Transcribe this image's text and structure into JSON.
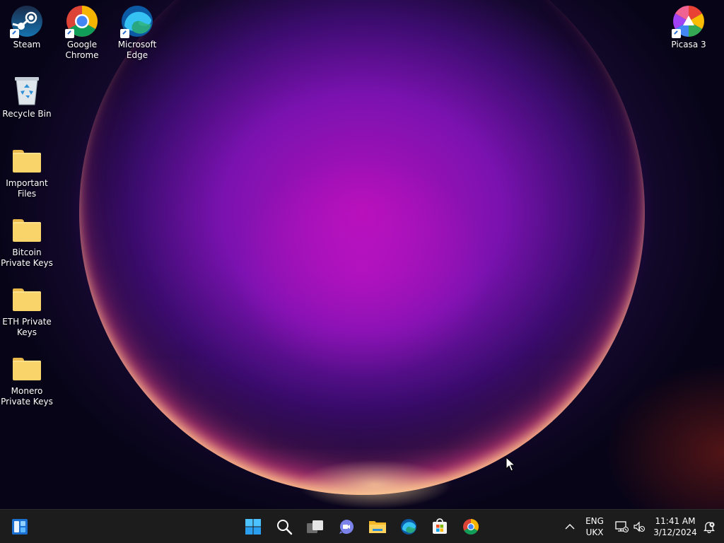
{
  "desktop": {
    "icons": [
      {
        "label": "Steam",
        "icon": "steam-icon"
      },
      {
        "label": "Google\nChrome",
        "icon": "chrome-icon"
      },
      {
        "label": "Microsoft\nEdge",
        "icon": "edge-icon"
      },
      {
        "label": "Picasa 3",
        "icon": "picasa-icon"
      },
      {
        "label": "Recycle Bin",
        "icon": "recycle-bin-icon"
      },
      {
        "label": "Important\nFiles",
        "icon": "folder-icon"
      },
      {
        "label": "Bitcoin\nPrivate Keys",
        "icon": "folder-icon"
      },
      {
        "label": "ETH Private\nKeys",
        "icon": "folder-icon"
      },
      {
        "label": "Monero\nPrivate Keys",
        "icon": "folder-icon"
      }
    ]
  },
  "taskbar": {
    "pinned": [
      "start-icon",
      "search-icon",
      "task-view-icon",
      "chat-icon",
      "file-explorer-icon",
      "edge-icon",
      "microsoft-store-icon",
      "chrome-icon"
    ],
    "tray": {
      "language": "ENG",
      "keyboard": "UKX",
      "time": "11:41 AM",
      "date": "3/12/2024"
    }
  },
  "colors": {
    "taskbar": "#1c1c1c",
    "folder": "#f8d46a",
    "accent": "#0078d4"
  }
}
